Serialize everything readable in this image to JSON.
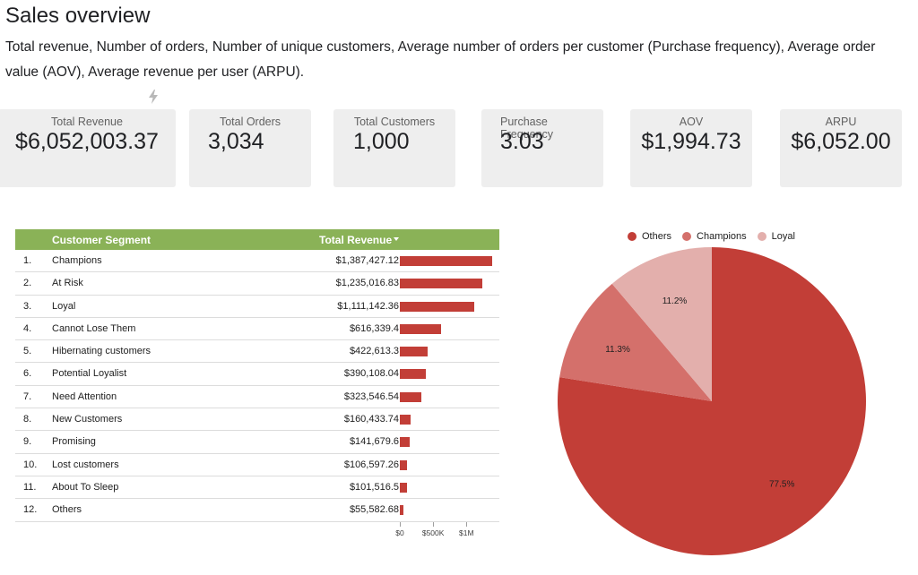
{
  "header": {
    "title": "Sales overview",
    "description": "Total revenue, Number of orders, Number of unique customers, Average number of orders per customer (Purchase frequency), Average order value (AOV), Average revenue per user (ARPU)."
  },
  "icons": {
    "bolt": "lightning-bolt-icon"
  },
  "kpis": [
    {
      "label": "Total Revenue",
      "value": "$6,052,003.37"
    },
    {
      "label": "Total Orders",
      "value": "3,034"
    },
    {
      "label": "Total Customers",
      "value": "1,000"
    },
    {
      "label": "Purchase Frequency",
      "value": "3.03"
    },
    {
      "label": "AOV",
      "value": "$1,994.73"
    },
    {
      "label": "ARPU",
      "value": "$6,052.00"
    }
  ],
  "table": {
    "columns": [
      "Customer Segment",
      "Total Revenue"
    ],
    "sort_indicator": "descending",
    "bar_color": "#c23e37",
    "header_color": "#8ab257",
    "rows": [
      {
        "idx": "1.",
        "segment": "Champions",
        "revenue_label": "$1,387,427.12",
        "revenue": 1387427.12
      },
      {
        "idx": "2.",
        "segment": "At Risk",
        "revenue_label": "$1,235,016.83",
        "revenue": 1235016.83
      },
      {
        "idx": "3.",
        "segment": "Loyal",
        "revenue_label": "$1,111,142.36",
        "revenue": 1111142.36
      },
      {
        "idx": "4.",
        "segment": "Cannot Lose Them",
        "revenue_label": "$616,339.4",
        "revenue": 616339.4
      },
      {
        "idx": "5.",
        "segment": "Hibernating customers",
        "revenue_label": "$422,613.3",
        "revenue": 422613.3
      },
      {
        "idx": "6.",
        "segment": "Potential Loyalist",
        "revenue_label": "$390,108.04",
        "revenue": 390108.04
      },
      {
        "idx": "7.",
        "segment": "Need Attention",
        "revenue_label": "$323,546.54",
        "revenue": 323546.54
      },
      {
        "idx": "8.",
        "segment": "New Customers",
        "revenue_label": "$160,433.74",
        "revenue": 160433.74
      },
      {
        "idx": "9.",
        "segment": "Promising",
        "revenue_label": "$141,679.6",
        "revenue": 141679.6
      },
      {
        "idx": "10.",
        "segment": "Lost customers",
        "revenue_label": "$106,597.26",
        "revenue": 106597.26
      },
      {
        "idx": "11.",
        "segment": "About To Sleep",
        "revenue_label": "$101,516.5",
        "revenue": 101516.5
      },
      {
        "idx": "12.",
        "segment": "Others",
        "revenue_label": "$55,582.68",
        "revenue": 55582.68
      }
    ],
    "axis": {
      "max": 1400000,
      "ticks": [
        {
          "value": 0,
          "label": "$0"
        },
        {
          "value": 500000,
          "label": "$500K"
        },
        {
          "value": 1000000,
          "label": "$1M"
        }
      ]
    }
  },
  "chart_data": {
    "type": "pie",
    "title": "",
    "legend_position": "top",
    "slices": [
      {
        "name": "Others",
        "value": 77.5,
        "label": "77.5%",
        "color": "#c23e37"
      },
      {
        "name": "Champions",
        "value": 11.3,
        "label": "11.3%",
        "color": "#d4706b"
      },
      {
        "name": "Loyal",
        "value": 11.2,
        "label": "11.2%",
        "color": "#e3afac"
      }
    ],
    "start": "12 o'clock",
    "direction": "clockwise"
  }
}
